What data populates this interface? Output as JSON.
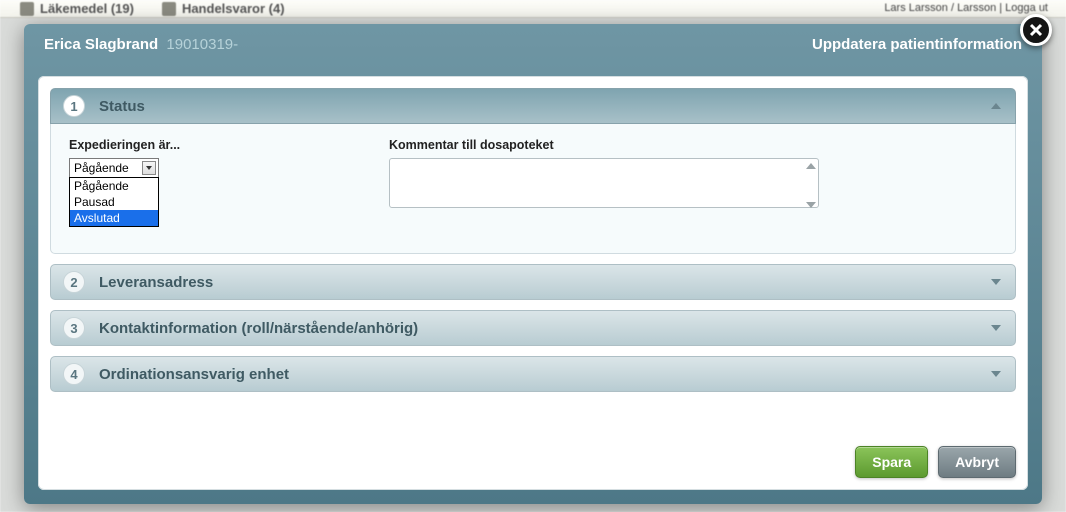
{
  "backdrop": {
    "tab1": "Läkemedel (19)",
    "tab2": "Handelsvaror (4)",
    "userbar": "Lars Larsson / Larsson | Logga ut"
  },
  "header": {
    "patient_name": "Erica Slagbrand",
    "patient_ssn": "19010319-",
    "dialog_title": "Uppdatera patientinformation"
  },
  "sections": {
    "s1": {
      "num": "1",
      "title": "Status"
    },
    "s2": {
      "num": "2",
      "title": "Leveransadress"
    },
    "s3": {
      "num": "3",
      "title": "Kontaktinformation (roll/närstående/anhörig)"
    },
    "s4": {
      "num": "4",
      "title": "Ordinationsansvarig enhet"
    }
  },
  "status_panel": {
    "exp_label": "Expedieringen är...",
    "selected": "Pågående",
    "options": {
      "o1": "Pågående",
      "o2": "Pausad",
      "o3": "Avslutad"
    },
    "comment_label": "Kommentar till dosapoteket",
    "comment_value": ""
  },
  "buttons": {
    "save": "Spara",
    "cancel": "Avbryt"
  }
}
